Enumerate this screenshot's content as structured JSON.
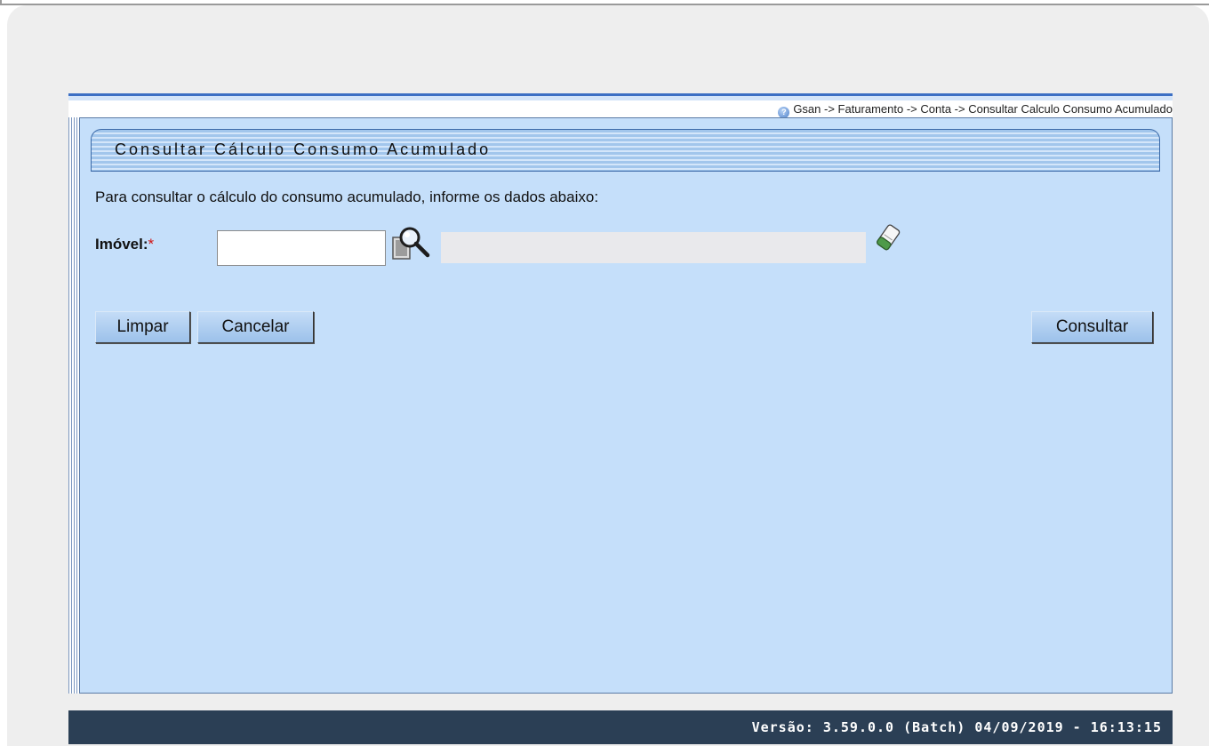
{
  "breadcrumb": "Gsan -> Faturamento -> Conta -> Consultar Calculo Consumo Acumulado",
  "page_title": "Consultar Cálculo Consumo Acumulado",
  "instruction": "Para consultar o cálculo do consumo acumulado, informe os dados abaixo:",
  "form": {
    "imovel_label": "Imóvel:",
    "required_marker": "*",
    "imovel_value": "",
    "imovel_description": ""
  },
  "buttons": {
    "limpar": "Limpar",
    "cancelar": "Cancelar",
    "consultar": "Consultar"
  },
  "footer": {
    "version": "Versão: 3.59.0.0 (Batch) 04/09/2019 - 16:13:15"
  },
  "icons": {
    "help": "help-icon",
    "search": "magnifier-search-icon",
    "clear": "eraser-icon"
  },
  "colors": {
    "content_bg": "#c5dffa",
    "footer_bg": "#2b3f55",
    "button_bg": "#9cc1ea",
    "required": "#d01010"
  }
}
